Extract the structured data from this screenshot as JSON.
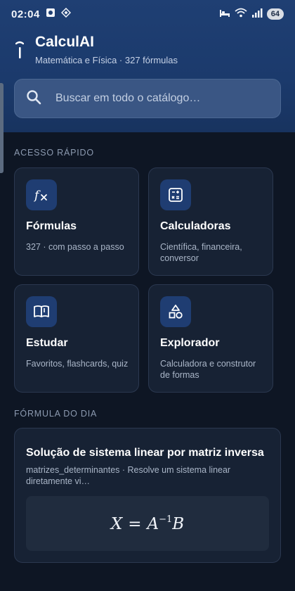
{
  "status_bar": {
    "time": "02:04",
    "battery": "64",
    "icons": [
      "notification-icon",
      "app-icon",
      "bed-icon",
      "wifi-icon",
      "signal-icon"
    ]
  },
  "app": {
    "title": "CalculAI",
    "subtitle": "Matemática e Física · 327 fórmulas"
  },
  "search": {
    "placeholder": "Buscar em todo o catálogo…"
  },
  "quick_access": {
    "label": "ACESSO RÁPIDO",
    "cards": [
      {
        "title": "Fórmulas",
        "desc": "327 · com passo a passo",
        "icon": "function-icon"
      },
      {
        "title": "Calculadoras",
        "desc": "Científica, financeira, conversor",
        "icon": "calculator-icon"
      },
      {
        "title": "Estudar",
        "desc": "Favoritos, flashcards, quiz",
        "icon": "book-icon"
      },
      {
        "title": "Explorador",
        "desc": "Calculadora e construtor de formas",
        "icon": "shapes-icon"
      }
    ]
  },
  "formula_of_day": {
    "label": "FÓRMULA DO DIA",
    "title": "Solução de sistema linear por matriz inversa",
    "desc": "matrizes_determinantes · Resolve um sistema linear diretamente vi…",
    "formula": {
      "lhs": "X",
      "eq": "=",
      "base": "A",
      "exp": "−1",
      "rhs": "B"
    }
  },
  "colors": {
    "header": "#1f3f73",
    "background": "#0e1624",
    "card": "#172234",
    "icon_box": "#1f3d72"
  }
}
